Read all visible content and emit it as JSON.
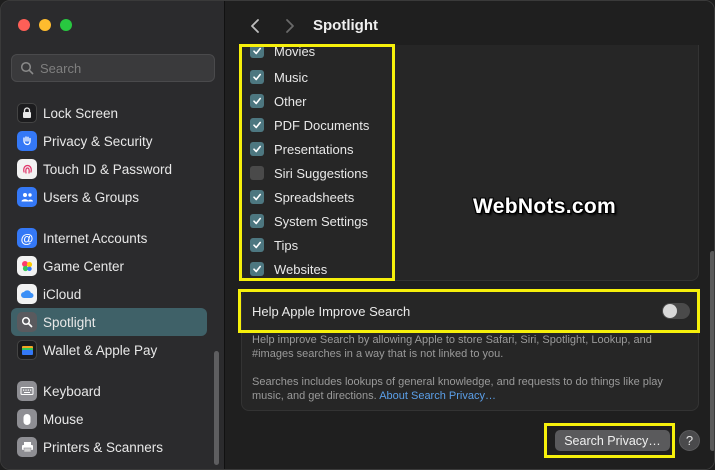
{
  "window": {
    "title": "Spotlight"
  },
  "sidebar": {
    "search_placeholder": "Search",
    "items": [
      {
        "label": "Lock Screen",
        "icon": "lock-icon",
        "color": "#1c1c1e"
      },
      {
        "label": "Privacy & Security",
        "icon": "hand-icon",
        "color": "#3478f6"
      },
      {
        "label": "Touch ID & Password",
        "icon": "fingerprint-icon",
        "color": "#f2f2f2"
      },
      {
        "label": "Users & Groups",
        "icon": "users-icon",
        "color": "#3478f6"
      },
      {
        "label": "Internet Accounts",
        "icon": "at-icon",
        "color": "#3478f6"
      },
      {
        "label": "Game Center",
        "icon": "game-center-icon",
        "color": "#f2f2f2"
      },
      {
        "label": "iCloud",
        "icon": "cloud-icon",
        "color": "#f2f2f2"
      },
      {
        "label": "Spotlight",
        "icon": "magnifier-icon",
        "color": "#5a5a5e",
        "active": true
      },
      {
        "label": "Wallet & Apple Pay",
        "icon": "wallet-icon",
        "color": "#1c1c1e"
      },
      {
        "label": "Keyboard",
        "icon": "keyboard-icon",
        "color": "#8e8e93"
      },
      {
        "label": "Mouse",
        "icon": "mouse-icon",
        "color": "#8e8e93"
      },
      {
        "label": "Printers & Scanners",
        "icon": "printer-icon",
        "color": "#8e8e93"
      }
    ]
  },
  "categories": [
    {
      "label": "Movies",
      "checked": true
    },
    {
      "label": "Music",
      "checked": true
    },
    {
      "label": "Other",
      "checked": true
    },
    {
      "label": "PDF Documents",
      "checked": true
    },
    {
      "label": "Presentations",
      "checked": true
    },
    {
      "label": "Siri Suggestions",
      "checked": false
    },
    {
      "label": "Spreadsheets",
      "checked": true
    },
    {
      "label": "System Settings",
      "checked": true
    },
    {
      "label": "Tips",
      "checked": true
    },
    {
      "label": "Websites",
      "checked": true
    }
  ],
  "improve": {
    "label": "Help Apple Improve Search",
    "enabled": false,
    "desc1": "Help improve Search by allowing Apple to store Safari, Siri, Spotlight, Lookup, and #images searches in a way that is not linked to you.",
    "desc2": "Searches includes lookups of general knowledge, and requests to do things like play music, and get directions.",
    "link": "About Search Privacy…"
  },
  "buttons": {
    "search_privacy": "Search Privacy…",
    "help": "?"
  },
  "watermark": "WebNots.com",
  "colors": {
    "accent": "#4d7780",
    "highlight": "#f6f00b",
    "link": "#5b9fe8"
  }
}
